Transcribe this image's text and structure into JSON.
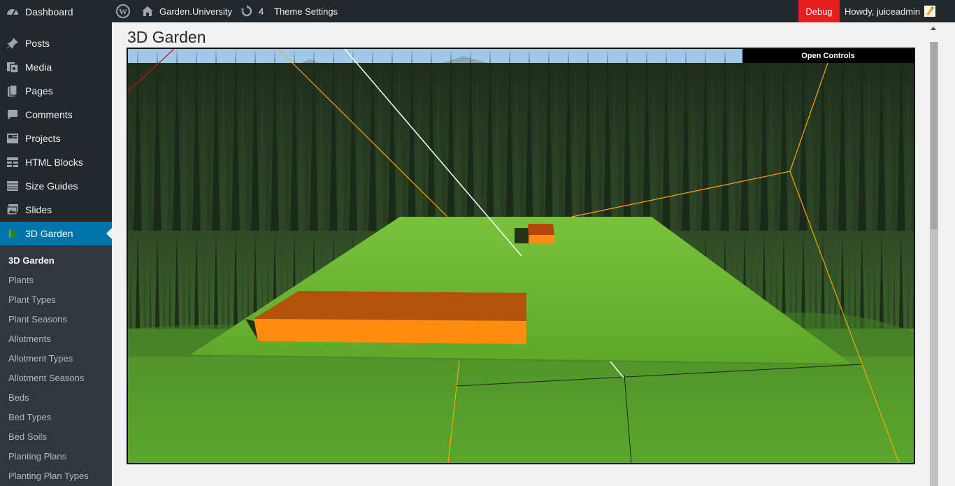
{
  "adminbar": {
    "site_name": "Garden.University",
    "updates_count": "4",
    "theme_settings": "Theme Settings",
    "debug": "Debug",
    "howdy": "Howdy, juiceadmin"
  },
  "sidebar": {
    "items": [
      {
        "label": "Dashboard",
        "icon": "dashboard-icon"
      },
      {
        "label": "Posts",
        "icon": "pin-icon"
      },
      {
        "label": "Media",
        "icon": "media-icon"
      },
      {
        "label": "Pages",
        "icon": "pages-icon"
      },
      {
        "label": "Comments",
        "icon": "comment-icon"
      },
      {
        "label": "Projects",
        "icon": "portfolio-icon"
      },
      {
        "label": "HTML Blocks",
        "icon": "blocks-icon"
      },
      {
        "label": "Size Guides",
        "icon": "table-icon"
      },
      {
        "label": "Slides",
        "icon": "slides-icon"
      },
      {
        "label": "3D Garden",
        "icon": "garden-icon"
      }
    ],
    "submenu": [
      "3D Garden",
      "Plants",
      "Plant Types",
      "Plant Seasons",
      "Allotments",
      "Allotment Types",
      "Allotment Seasons",
      "Beds",
      "Bed Types",
      "Bed Soils",
      "Planting Plans",
      "Planting Plan Types"
    ]
  },
  "main": {
    "title": "3D Garden",
    "controls_button": "Open Controls"
  },
  "colors": {
    "adminbar_bg": "#23282d",
    "menu_current": "#0073aa",
    "debug_bg": "#e81e1e",
    "grass": "#6fb52b",
    "bed_top": "#b5520a",
    "bed_side": "#ff8c0f",
    "helper_lines": "#ffa500"
  }
}
